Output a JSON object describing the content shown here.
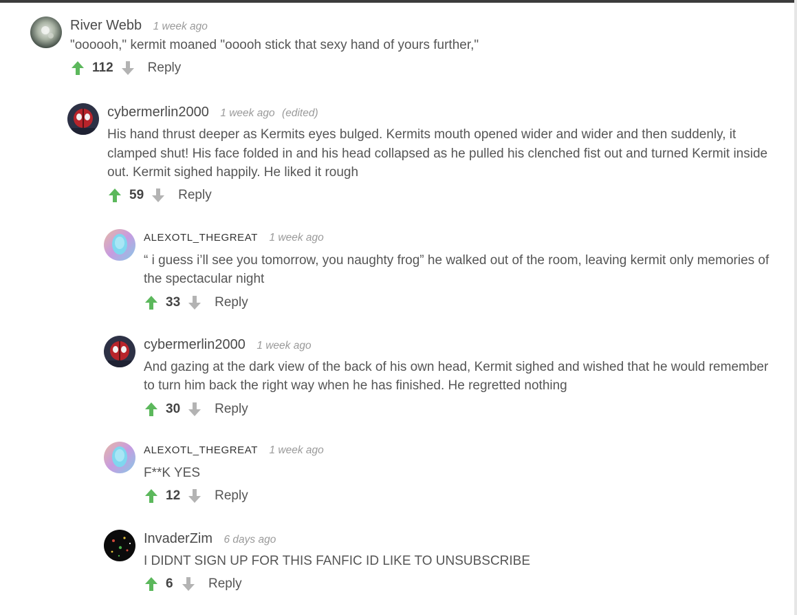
{
  "colors": {
    "upvote": "#5cb85c",
    "downvote": "#b3b3b3",
    "text": "#555555",
    "timestamp": "#9a9a9a"
  },
  "icons": {
    "upvote": "arrow-up-icon",
    "downvote": "arrow-down-icon"
  },
  "comments": [
    {
      "author": "River Webb",
      "time": "1 week ago",
      "text": "\"oooooh,\" kermit moaned \"ooooh stick that sexy hand of yours further,\"",
      "score": "112",
      "reply_label": "Reply"
    },
    {
      "author": "cybermerlin2000",
      "time": "1 week ago",
      "edited": "(edited)",
      "text": "His hand thrust deeper as Kermits eyes bulged. Kermits mouth opened wider and wider and then suddenly, it clamped shut! His face folded in and his head collapsed as he pulled his clenched fist out and turned Kermit inside out. Kermit sighed happily. He liked it rough",
      "score": "59",
      "reply_label": "Reply"
    },
    {
      "author": "ALEXOTL_THEGREAT",
      "time": "1 week ago",
      "text": "“ i guess i’ll see you tomorrow, you naughty frog” he walked out of the room, leaving kermit only memories of the spectacular night",
      "score": "33",
      "reply_label": "Reply"
    },
    {
      "author": "cybermerlin2000",
      "time": "1 week ago",
      "text": "And gazing at the dark view of the back of his own head, Kermit sighed and wished that he would remember to turn him back the right way when he has finished. He regretted nothing",
      "score": "30",
      "reply_label": "Reply"
    },
    {
      "author": "ALEXOTL_THEGREAT",
      "time": "1 week ago",
      "text": "F**K YES",
      "score": "12",
      "reply_label": "Reply"
    },
    {
      "author": "InvaderZim",
      "time": "6 days ago",
      "text": "I DIDNT SIGN UP FOR THIS FANFIC ID LIKE TO UNSUBSCRIBE",
      "score": "6",
      "reply_label": "Reply"
    }
  ]
}
